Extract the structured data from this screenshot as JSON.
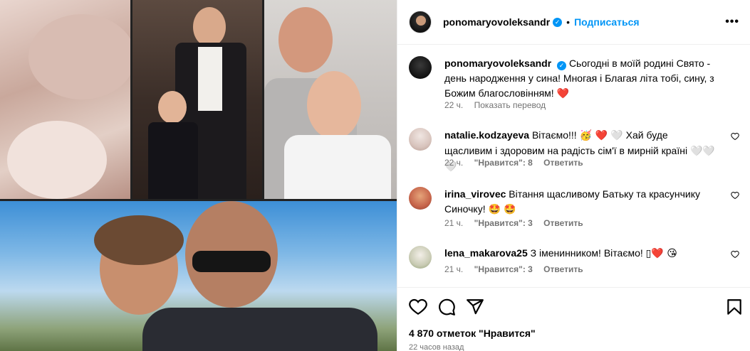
{
  "media": {
    "photos": [
      "photo-baby",
      "photo-suit",
      "photo-selfie",
      "photo-beach"
    ]
  },
  "header": {
    "username": "ponomaryovoleksandr",
    "verified_icon": "verified-badge-icon",
    "dot": "•",
    "follow_label": "Подписаться",
    "more_icon": "more-options-icon",
    "more_glyph": "•••"
  },
  "caption": {
    "username": "ponomaryovoleksandr",
    "text": "Сьогодні в моїй родині Свято - день народження у сина! Многая і Благая літа тобі, сину, з Божим благословінням! ",
    "emoji": "❤️",
    "time": "22 ч.",
    "translate_label": "Показать перевод"
  },
  "comments": [
    {
      "username": "natalie.kodzayeva",
      "text": "Вітаємо!!!",
      "emoji": "🥳 ❤️ 🤍",
      "text2": "Хай буде щасливим і здоровим на радість сім'ї в мирній країні ",
      "emoji2": "🤍🤍🤍",
      "time": "22 ч.",
      "likes": "\"Нравится\": 8",
      "reply_label": "Ответить"
    },
    {
      "username": "irina_virovec",
      "text": "Вітання щасливому Батьку та красунчику Синочку! ",
      "emoji": "🤩 🤩",
      "time": "21 ч.",
      "likes": "\"Нравится\": 3",
      "reply_label": "Ответить"
    },
    {
      "username": "lena_makarova25",
      "text": "З іменинником! Вітаємо! ",
      "emoji": "▯❤️ 😘",
      "time": "21 ч.",
      "likes": "\"Нравится\": 3",
      "reply_label": "Ответить"
    }
  ],
  "actions": {
    "like_icon": "heart-icon",
    "comment_icon": "comment-icon",
    "share_icon": "share-icon",
    "save_icon": "bookmark-icon",
    "likes_count": "4 870 отметок \"Нравится\"",
    "posted": "22 часов назад"
  },
  "colors": {
    "accent": "#0095f6",
    "muted": "#737373",
    "heart": "#ed4956",
    "border": "#efefef"
  }
}
